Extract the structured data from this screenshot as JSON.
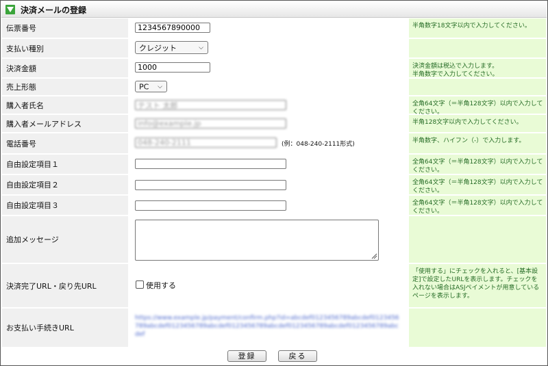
{
  "header": {
    "title": "決済メールの登録"
  },
  "form": {
    "slip_number": {
      "label": "伝票番号",
      "value": "1234567890000",
      "help": "半角数字18文字以内で入力してください。"
    },
    "payment_type": {
      "label": "支払い種別",
      "selected": "クレジット"
    },
    "amount": {
      "label": "決済金額",
      "value": "1000",
      "help": "決済金額は税込で入力します。\n半角数字で入力してください。"
    },
    "sales_type": {
      "label": "売上形態",
      "selected": "PC"
    },
    "buyer_name": {
      "label": "購入者氏名",
      "value": "テスト 太郎",
      "help": "全角64文字（＝半角128文字）以内で入力してください。"
    },
    "buyer_email": {
      "label": "購入者メールアドレス",
      "value": "info@example.jp",
      "help": "半角128文字以内で入力してください。"
    },
    "phone": {
      "label": "電話番号",
      "value": "048-240-2111",
      "example": "(例：048-240-2111形式)",
      "help": "半角数字、ハイフン（-）で入力します。"
    },
    "free1": {
      "label": "自由設定項目１",
      "value": "",
      "help": "全角64文字（＝半角128文字）以内で入力してください。"
    },
    "free2": {
      "label": "自由設定項目２",
      "value": "",
      "help": "全角64文字（＝半角128文字）以内で入力してください。"
    },
    "free3": {
      "label": "自由設定項目３",
      "value": "",
      "help": "全角64文字（＝半角128文字）以内で入力してください。"
    },
    "message": {
      "label": "追加メッセージ",
      "value": ""
    },
    "completion_url": {
      "label": "決済完了URL・戻り先URL",
      "checkbox_label": "使用する",
      "checked": false,
      "help": "「使用する」にチェックを入れると、[基本設定]で設定したURLを表示します。チェックを入れない場合はASJペイメントが用意しているページを表示します。"
    },
    "payment_url": {
      "label": "お支払い手続きURL",
      "value": "https://www.example.jp/payment/confirm.php?id=abcdef0123456789abcdef0123456789abcdef0123456789abcdef0123456789abcdef0123456789abcdef0123456789abcdef"
    }
  },
  "buttons": {
    "register": "登録",
    "back": "戻る"
  },
  "colors": {
    "help_bg": "#e9fbd6",
    "help_text": "#246b24",
    "label_bg": "#f0f0f0",
    "title_icon": "#3aa43a"
  }
}
